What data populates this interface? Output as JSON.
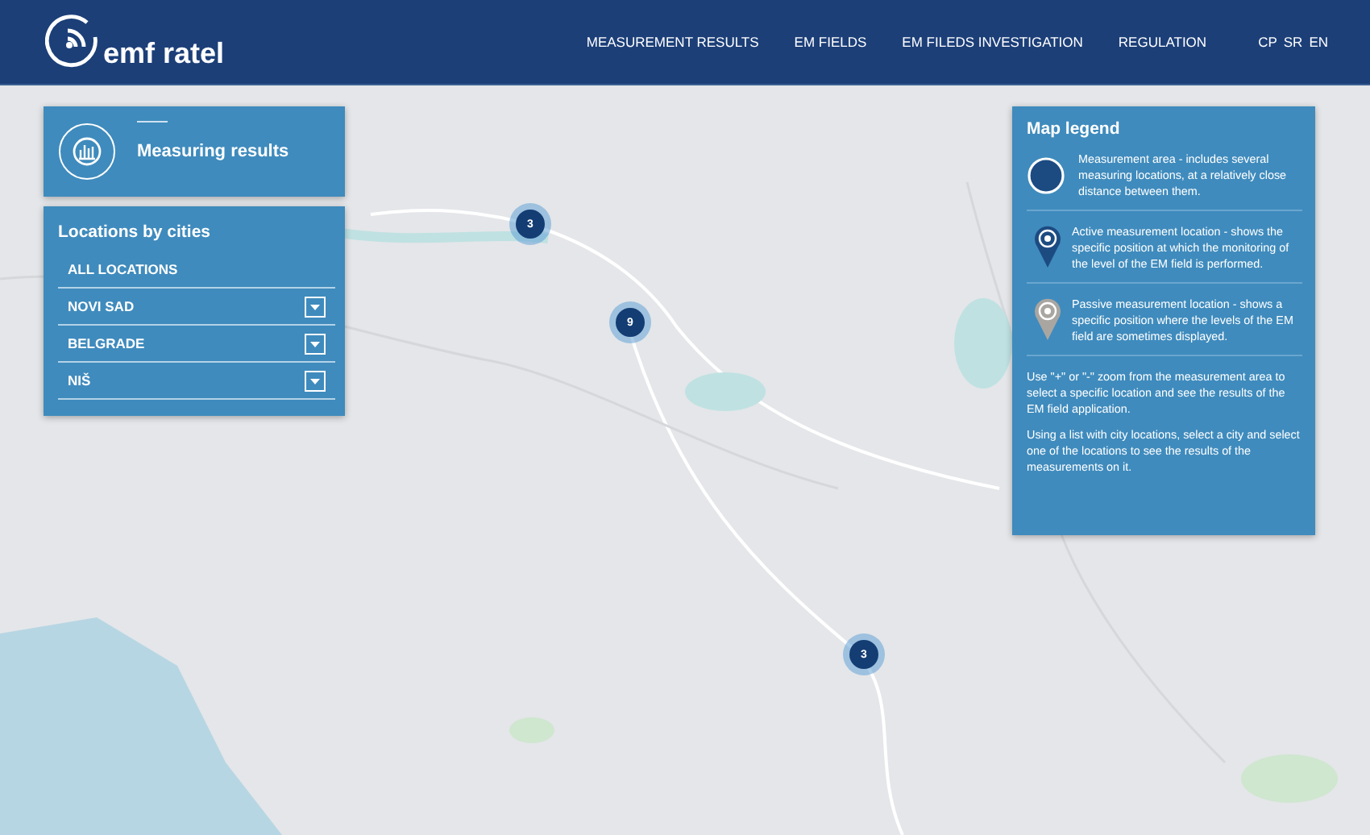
{
  "header": {
    "logo": "emf ratel",
    "nav": [
      {
        "label": "MEASUREMENT RESULTS"
      },
      {
        "label": "EM FIELDS"
      },
      {
        "label": "EM FILEDS INVESTIGATION"
      },
      {
        "label": "REGULATION"
      }
    ],
    "languages": [
      {
        "label": "CP"
      },
      {
        "label": "SR"
      },
      {
        "label": "EN"
      }
    ]
  },
  "map": {
    "markers": [
      {
        "count": "3"
      },
      {
        "count": "9"
      },
      {
        "count": "3"
      }
    ]
  },
  "results_panel": {
    "title": "Measuring results"
  },
  "locations_panel": {
    "title": "Locations by cities",
    "items": [
      {
        "label": "ALL LOCATIONS",
        "expandable": false
      },
      {
        "label": "NOVI SAD",
        "expandable": true
      },
      {
        "label": "BELGRADE",
        "expandable": true
      },
      {
        "label": "NIŠ",
        "expandable": true
      }
    ]
  },
  "legend": {
    "title": "Map legend",
    "items": [
      {
        "kind": "area",
        "text": "Measurement area - includes several measuring locations, at a relatively close distance between them."
      },
      {
        "kind": "active",
        "text": "Active measurement location - shows the specific position at which the monitoring of the level of the EM field is performed."
      },
      {
        "kind": "passive",
        "text": "Passive measurement location - shows a specific position where the levels of the EM field are sometimes displayed."
      }
    ],
    "notes": [
      "Use \"+\" or \"-\" zoom from the measurement area to select a specific location and see the results of the EM field application.",
      "Using a list with city locations, select a city and select one of the locations to see the results of the measurements on it."
    ]
  }
}
